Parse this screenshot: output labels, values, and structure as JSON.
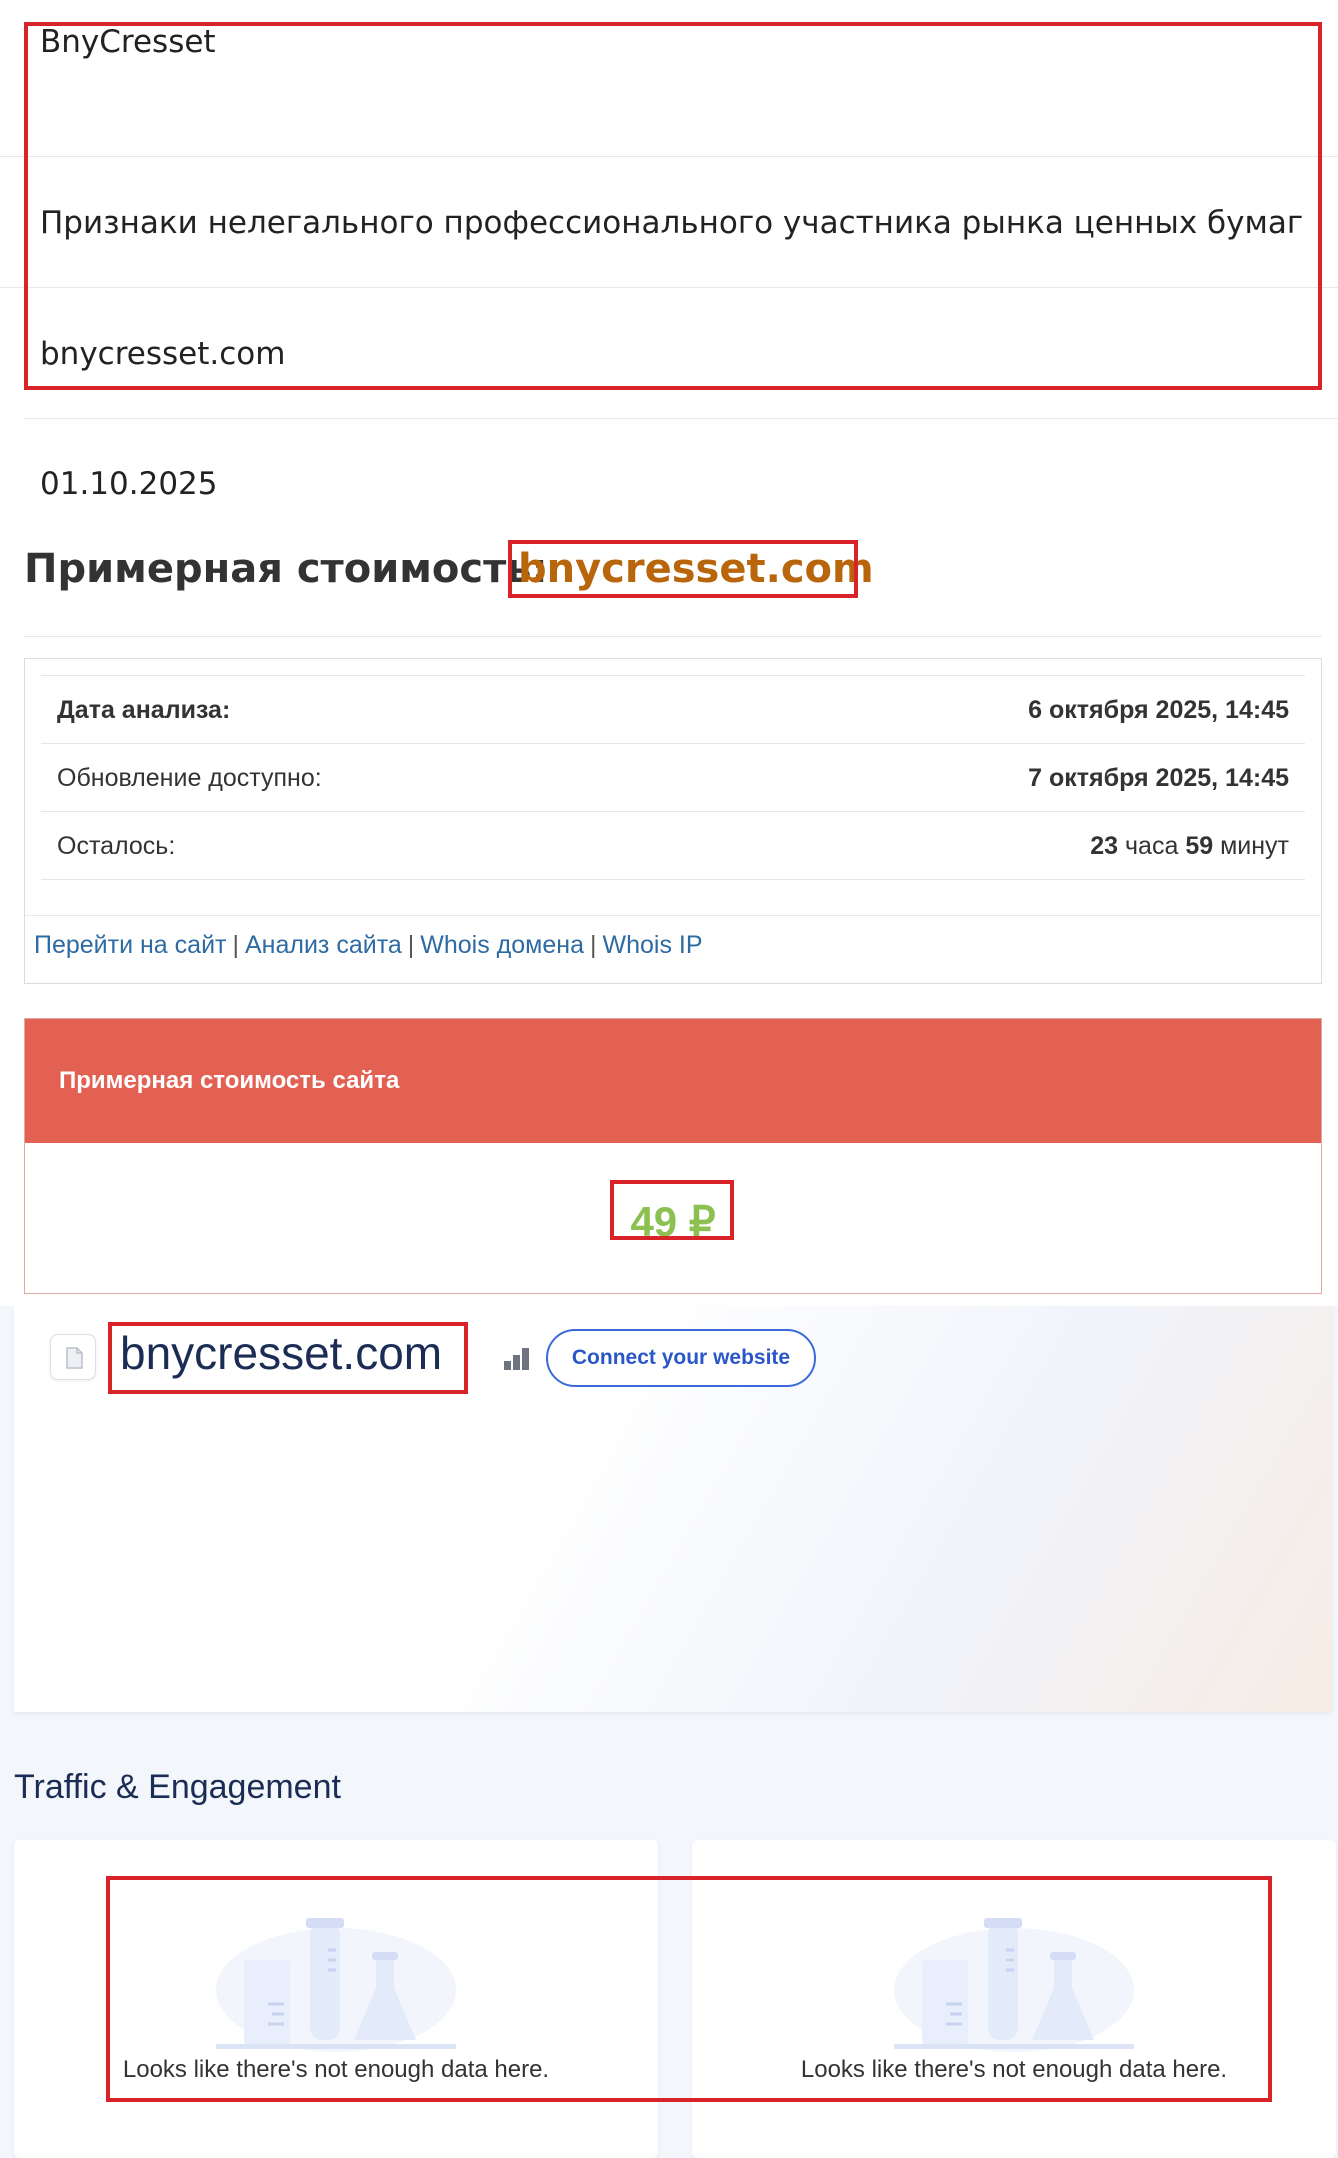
{
  "site": {
    "name": "BnyCresset",
    "status": "Признаки нелегального профессионального участника рынка ценных бумаг",
    "domain": "bnycresset.com",
    "date": "01.10.2025"
  },
  "estimate_page": {
    "heading": "Примерная стоимость:",
    "domain": "bnycresset.com",
    "rows": [
      {
        "label": "Дата анализа:",
        "value": "6 октября 2025, 14:45"
      },
      {
        "label": "Обновление доступно:",
        "value": "7 октября 2025, 14:45"
      },
      {
        "label": "Осталось:",
        "value_hours_num": "23",
        "value_hours_word": "часа",
        "value_minutes_num": "59",
        "value_minutes_word": "минут"
      }
    ],
    "links": [
      "Перейти на сайт",
      "Анализ сайта",
      "Whois домена",
      "Whois IP"
    ],
    "link_separator": "|",
    "card_title": "Примерная стоимость сайта",
    "card_value": "49 ₽"
  },
  "similarweb": {
    "domain": "bnycresset.com",
    "connect_button": "Connect your website",
    "traffic_title": "Traffic & Engagement",
    "empty_messages": [
      "Looks like there's not enough data here.",
      "Looks like there's not enough data here."
    ]
  },
  "colors": {
    "highlight_red": "#d8232a",
    "domain_orange": "#b8650c",
    "card_header": "#e36153",
    "value_green": "#8cc152",
    "link_blue": "#2e6aa3",
    "sw_navy": "#1b2d55",
    "sw_blue": "#2a57c8"
  },
  "icons": [
    "file-icon",
    "rank-bars-icon",
    "lab-flasks-illustration"
  ]
}
